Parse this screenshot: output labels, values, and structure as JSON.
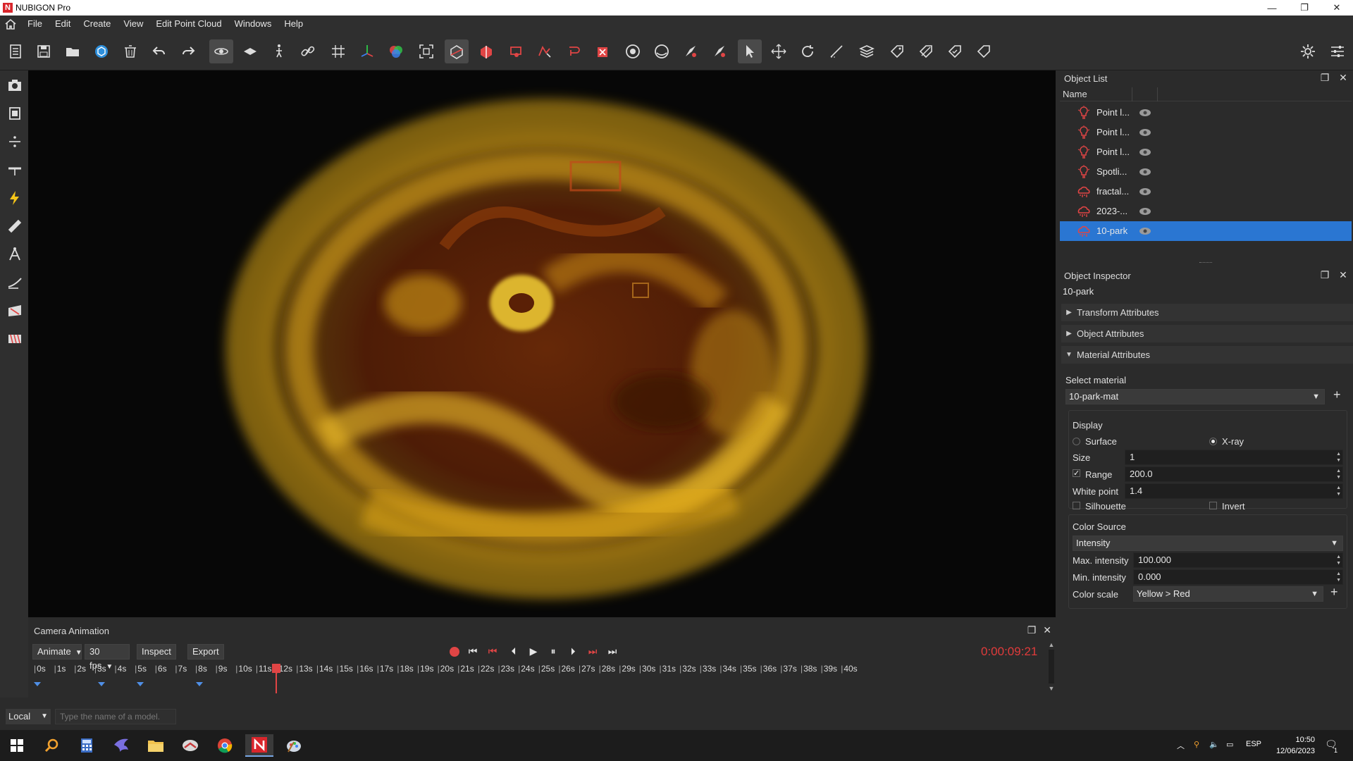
{
  "window": {
    "title": "NUBIGON Pro",
    "logo_letter": "N",
    "minimize": "—",
    "restore": "❐",
    "close": "✕"
  },
  "menu": [
    "File",
    "Edit",
    "Create",
    "View",
    "Edit Point Cloud",
    "Windows",
    "Help"
  ],
  "object_list": {
    "title": "Object List",
    "column_name": "Name",
    "items": [
      {
        "label": "Point l...",
        "icon": "lightbulb-icon"
      },
      {
        "label": "Point l...",
        "icon": "lightbulb-icon"
      },
      {
        "label": "Point l...",
        "icon": "lightbulb-icon"
      },
      {
        "label": "Spotli...",
        "icon": "lightbulb-icon"
      },
      {
        "label": "fractal...",
        "icon": "point-cloud-icon"
      },
      {
        "label": "2023-...",
        "icon": "point-cloud-icon"
      },
      {
        "label": "10-park",
        "icon": "point-cloud-icon"
      }
    ],
    "selected_index": 6
  },
  "inspector": {
    "title": "Object Inspector",
    "object_name": "10-park",
    "sections": [
      "Transform Attributes",
      "Object Attributes",
      "Material Attributes"
    ],
    "select_material_label": "Select material",
    "material_value": "10-park-mat",
    "display_label": "Display",
    "surface_label": "Surface",
    "xray_label": "X-ray",
    "size_label": "Size",
    "size_value": "1",
    "range_label": "Range",
    "range_value": "200.0",
    "white_point_label": "White point",
    "white_point_value": "1.4",
    "silhouette_label": "Silhouette",
    "invert_label": "Invert",
    "color_source_label": "Color Source",
    "color_source_value": "Intensity",
    "max_intensity_label": "Max. intensity",
    "max_intensity_value": "100.000",
    "min_intensity_label": "Min. intensity",
    "min_intensity_value": "0.000",
    "color_scale_label": "Color scale",
    "color_scale_value": "Yellow > Red"
  },
  "camera": {
    "title": "Camera Animation",
    "mode": "Animate",
    "fps": "30 fps",
    "inspect_label": "Inspect",
    "export_label": "Export",
    "timecode": "0:00:09:21",
    "ticks": [
      "0s",
      "1s",
      "2s",
      "3s",
      "4s",
      "5s",
      "6s",
      "7s",
      "8s",
      "9s",
      "10s",
      "11s",
      "12s",
      "13s",
      "14s",
      "15s",
      "16s",
      "17s",
      "18s",
      "19s",
      "20s",
      "21s",
      "22s",
      "23s",
      "24s",
      "25s",
      "26s",
      "27s",
      "28s",
      "29s",
      "30s",
      "31s",
      "32s",
      "33s",
      "34s",
      "35s",
      "36s",
      "37s",
      "38s",
      "39s",
      "40s"
    ]
  },
  "status": {
    "coordinate_mode": "Local",
    "model_placeholder": "Type the name of a model."
  },
  "taskbar": {
    "language": "ESP",
    "time": "10:50",
    "date": "12/06/2023",
    "notifications": "1"
  },
  "colors": {
    "accent": "#2a76d2",
    "record": "#e04545",
    "timecode": "#e03b3b"
  }
}
